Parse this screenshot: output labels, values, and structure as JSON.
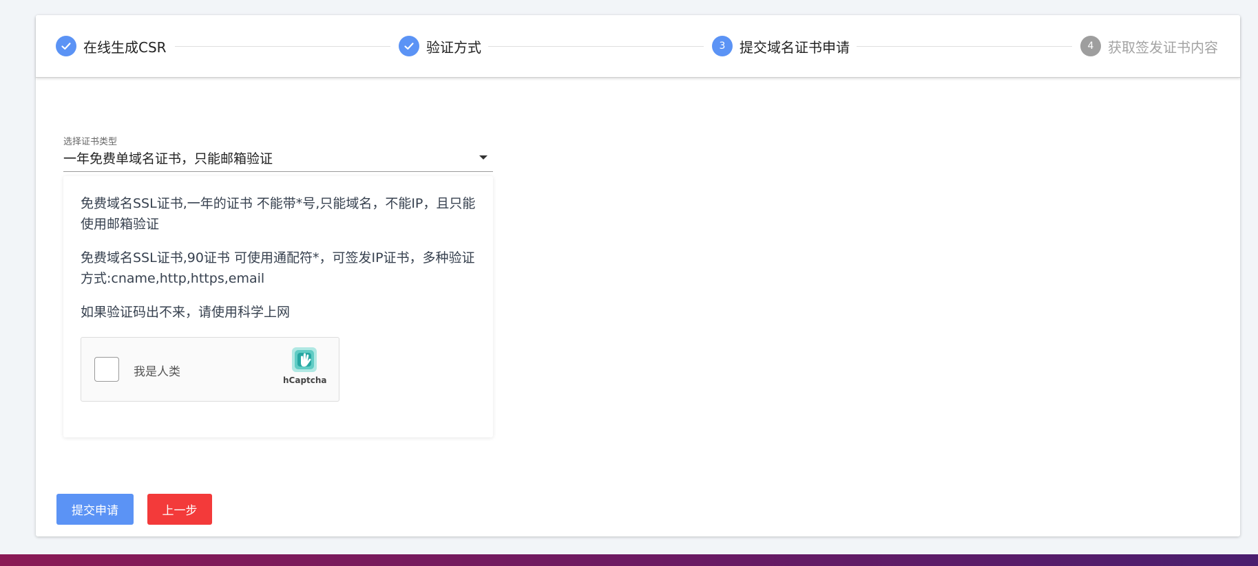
{
  "stepper": {
    "steps": [
      {
        "label": "在线生成CSR",
        "state": "done"
      },
      {
        "label": "验证方式",
        "state": "done"
      },
      {
        "number": "3",
        "label": "提交域名证书申请",
        "state": "active"
      },
      {
        "number": "4",
        "label": "获取签发证书内容",
        "state": "pending"
      }
    ]
  },
  "form": {
    "cert_type_caption": "选择证书类型",
    "cert_type_value": "一年免费单域名证书，只能邮箱验证"
  },
  "info": {
    "paragraph_1": "免费域名SSL证书,一年的证书 不能带*号,只能域名，不能IP，且只能使用邮箱验证",
    "paragraph_2": "免费域名SSL证书,90证书 可使用通配符*，可签发IP证书，多种验证方式:cname,http,https,email",
    "paragraph_3": "如果验证码出不来，请使用科学上网"
  },
  "captcha": {
    "label": "我是人类",
    "brand": "hCaptcha"
  },
  "buttons": {
    "submit_label": "提交申请",
    "prev_label": "上一步"
  },
  "colors": {
    "accent": "#5b93f5",
    "danger": "#f33a3a",
    "pending": "#9e9e9e"
  }
}
